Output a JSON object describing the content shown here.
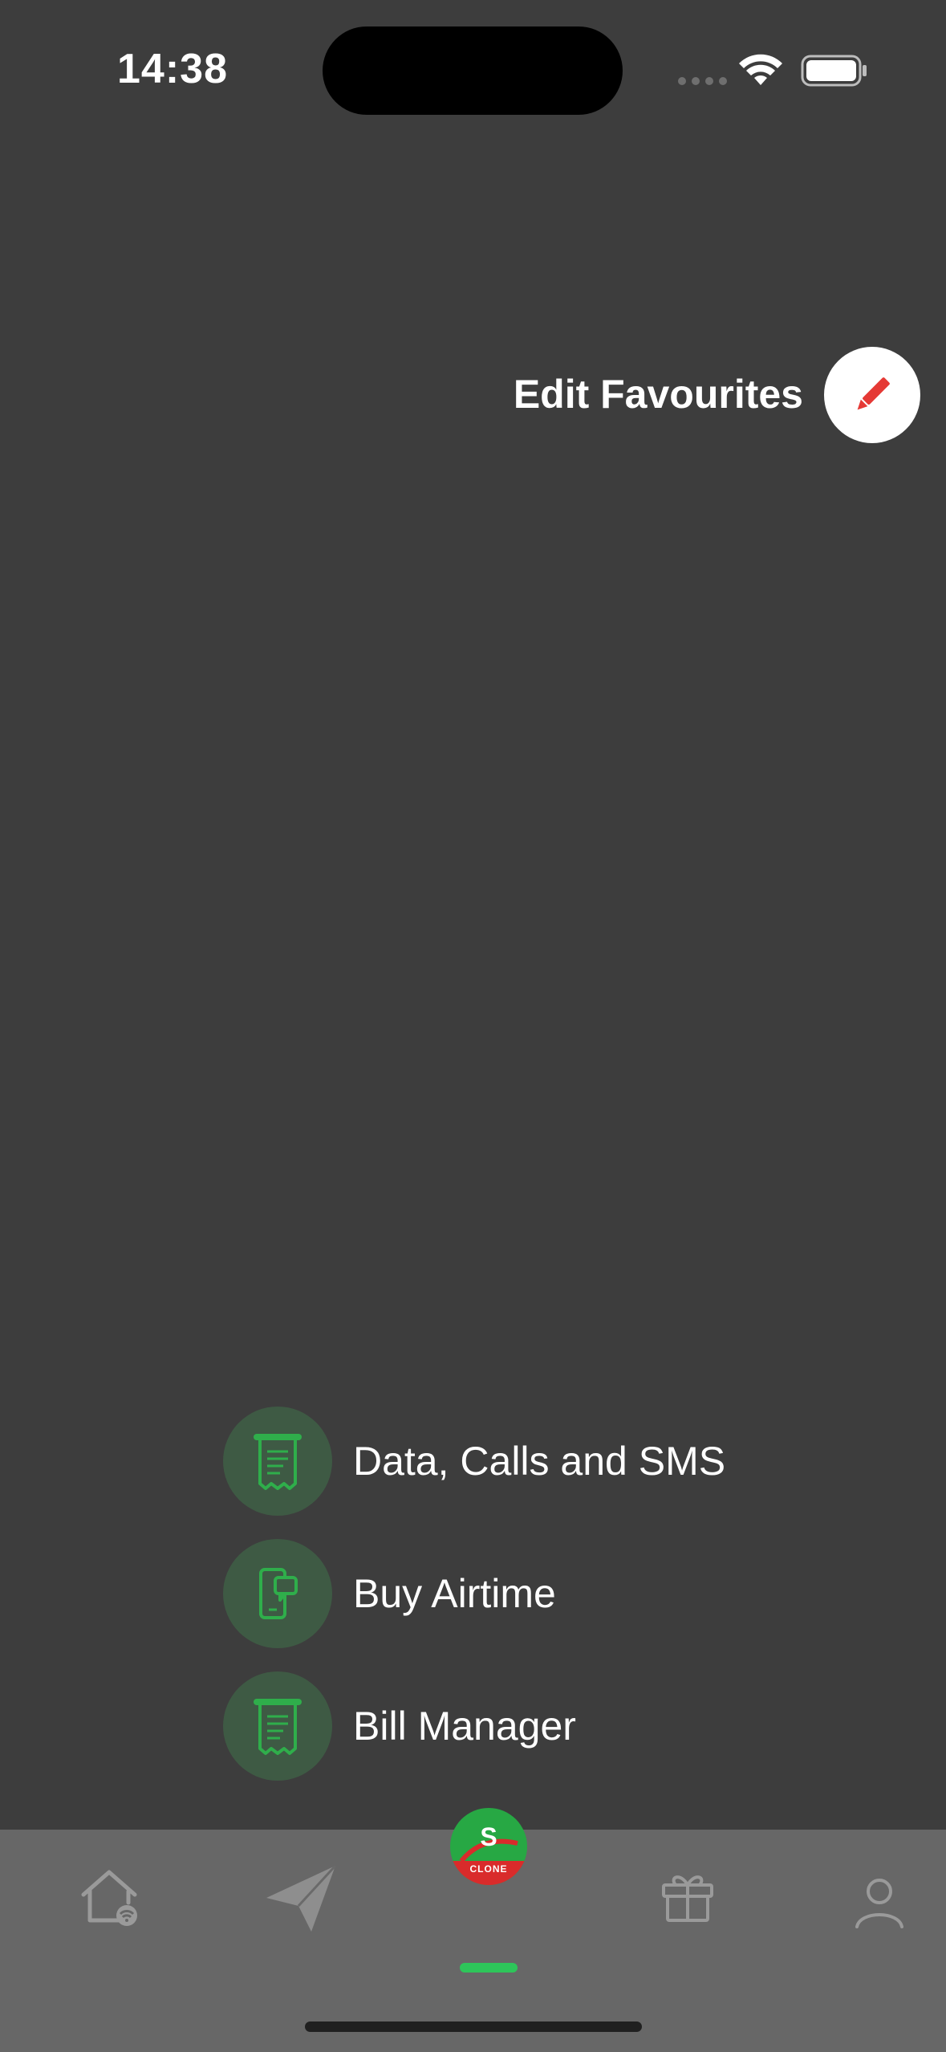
{
  "status_bar": {
    "time": "14:38"
  },
  "favourites": {
    "edit_label": "Edit Favourites"
  },
  "actions": [
    {
      "label": "Data, Calls and SMS",
      "icon": "receipt-icon"
    },
    {
      "label": "Buy Airtime",
      "icon": "phone-airtime-icon"
    },
    {
      "label": "Bill Manager",
      "icon": "receipt-icon"
    }
  ],
  "tabbar": {
    "tabs": [
      "home-wifi-icon",
      "send-icon",
      "logo",
      "gift-icon",
      "profile-icon"
    ],
    "logo_letter": "S",
    "logo_text": "CLONE",
    "active_color": "#2ec55a"
  },
  "colors": {
    "background": "#3d3d3d",
    "accent_green": "#2fae4b",
    "edit_icon_red": "#e53935",
    "tabbar": "#676767"
  }
}
